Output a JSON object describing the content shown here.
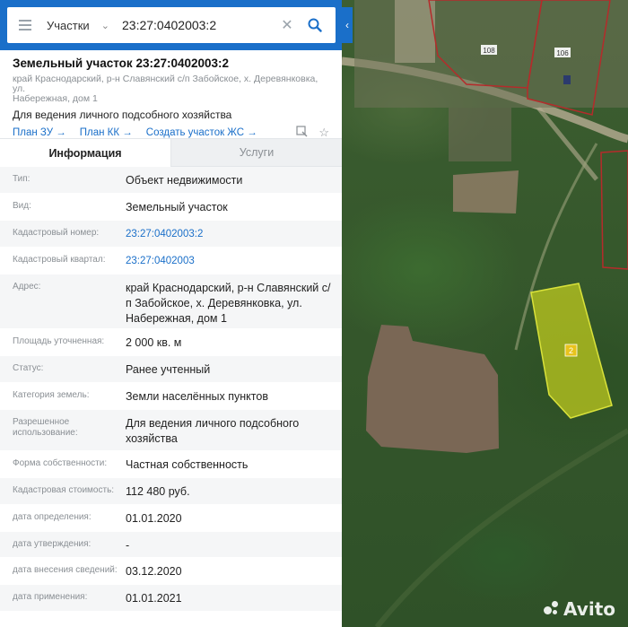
{
  "search": {
    "layer": "Участки",
    "query": "23:27:0402003:2"
  },
  "header": {
    "title": "Земельный участок 23:27:0402003:2",
    "address_line1": "край Краснодарский, р-н Славянский с/п Забойское, х. Деревянковка, ул.",
    "address_line2": "Набережная, дом 1",
    "purpose": "Для ведения личного подсобного хозяйства",
    "links": [
      "План ЗУ →",
      "План КК →",
      "Создать участок ЖС →"
    ]
  },
  "tabs": [
    "Информация",
    "Услуги"
  ],
  "rows": [
    {
      "k": "Тип:",
      "v": "Объект недвижимости"
    },
    {
      "k": "Вид:",
      "v": "Земельный участок"
    },
    {
      "k": "Кадастровый номер:",
      "v": "23:27:0402003:2"
    },
    {
      "k": "Кадастровый квартал:",
      "v": "23:27:0402003"
    },
    {
      "k": "Адрес:",
      "v": "край Краснодарский, р-н Славянский с/п Забойское, х. Деревянковка, ул. Набережная, дом 1"
    },
    {
      "k": "Площадь уточненная:",
      "v": "2 000 кв. м"
    },
    {
      "k": "Статус:",
      "v": "Ранее учтенный"
    },
    {
      "k": "Категория земель:",
      "v": "Земли населённых пунктов"
    },
    {
      "k": "Разрешенное использование:",
      "v": "Для ведения личного подсобного хозяйства"
    },
    {
      "k": "Форма собственности:",
      "v": "Частная собственность"
    },
    {
      "k": "Кадастровая стоимость:",
      "v": "112 480 руб."
    },
    {
      "k": "дата определения:",
      "v": "01.01.2020"
    },
    {
      "k": "дата утверждения:",
      "v": "-"
    },
    {
      "k": "дата внесения сведений:",
      "v": "03.12.2020"
    },
    {
      "k": "дата применения:",
      "v": "01.01.2021"
    }
  ],
  "map": {
    "plot_labels": [
      "108",
      "106",
      "2"
    ],
    "watermark": "Avito"
  },
  "colors": {
    "accent": "#1a6fc9",
    "parcel_highlight": "#c8d21e",
    "parcel_border": "#b52b2b"
  },
  "icons": {
    "menu": "hamburger-icon",
    "search": "search-icon",
    "clear": "close-icon",
    "measure": "ruler-icon",
    "favorite": "star-icon",
    "collapse": "chevron-left-icon"
  }
}
